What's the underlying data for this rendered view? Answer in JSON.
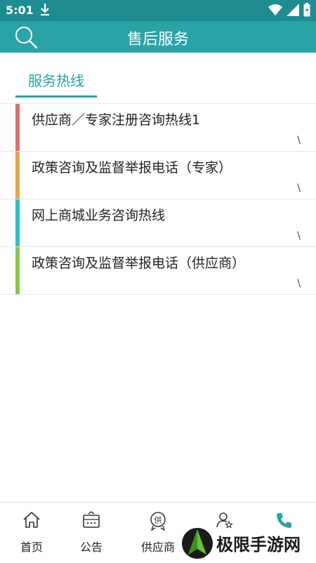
{
  "status_bar": {
    "time": "5:01"
  },
  "header": {
    "title": "售后服务"
  },
  "tabs": [
    {
      "label": "服务热线"
    }
  ],
  "hotlines": [
    {
      "label": "供应商／专家注册咨询热线1",
      "phone": "\\",
      "color": "#d9706e"
    },
    {
      "label": "政策咨询及监督举报电话（专家）",
      "phone": "\\",
      "color": "#e0a64f"
    },
    {
      "label": "网上商城业务咨询热线",
      "phone": "\\",
      "color": "#2fbdc4"
    },
    {
      "label": "政策咨询及监督举报电话（供应商）",
      "phone": "\\",
      "color": "#8bc34a"
    }
  ],
  "bottom_nav": {
    "items": [
      {
        "label": "首页",
        "icon": "home-icon"
      },
      {
        "label": "公告",
        "icon": "announcement-icon"
      },
      {
        "label": "供应商",
        "icon": "supplier-icon"
      },
      {
        "label": "",
        "icon": "user-star-icon"
      },
      {
        "label": "",
        "icon": "phone-icon"
      }
    ]
  },
  "watermark": {
    "text": "极限手游网"
  },
  "colors": {
    "primary": "#29a3a6",
    "status_bar": "#1f8c8f",
    "active_nav": "#29a3a6"
  }
}
